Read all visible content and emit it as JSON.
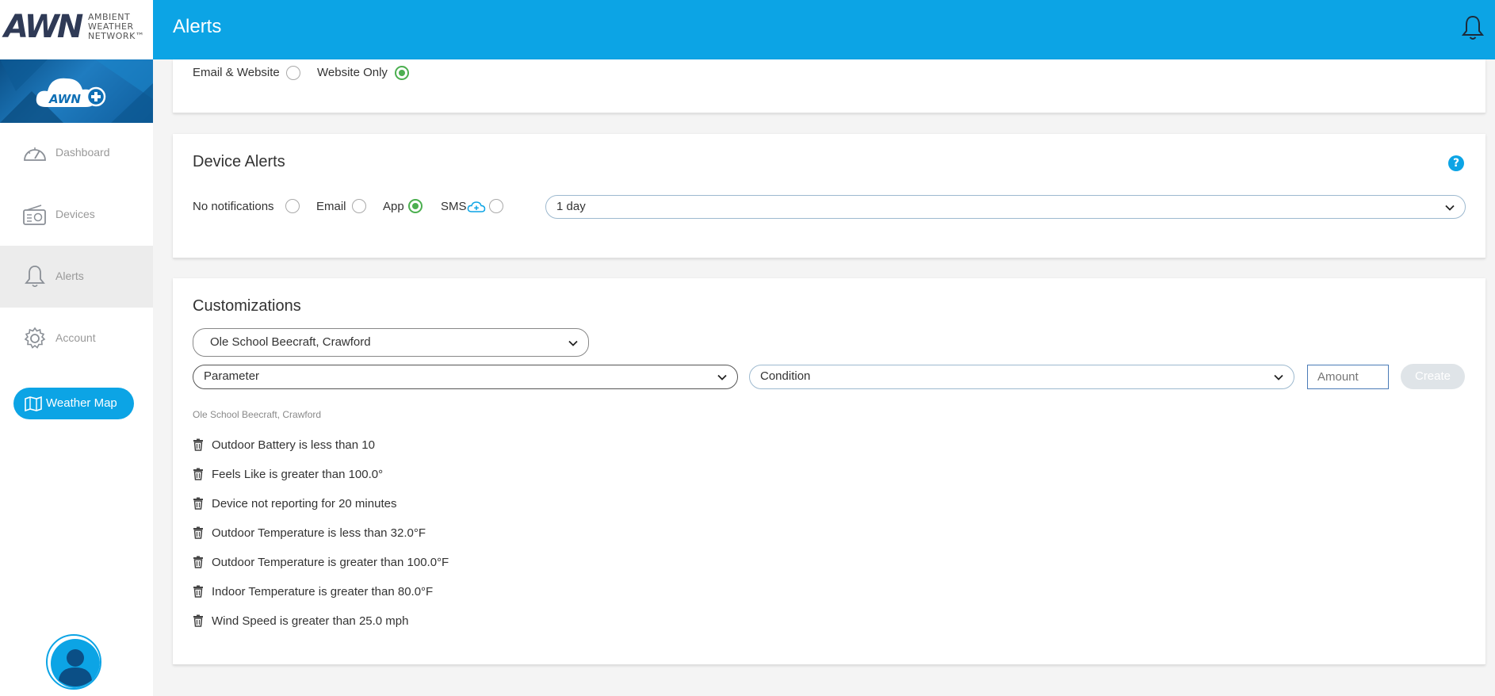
{
  "header": {
    "logo_text": "AWN",
    "logo_subtitle": [
      "AMBIENT",
      "WEATHER",
      "NETWORK™"
    ],
    "title": "Alerts",
    "bell_icon": "bell-icon"
  },
  "sidebar": {
    "banner_badge": "AWN",
    "items": [
      {
        "label": "Dashboard",
        "icon": "dashboard-gauge-icon",
        "active": false
      },
      {
        "label": "Devices",
        "icon": "radio-device-icon",
        "active": false
      },
      {
        "label": "Alerts",
        "icon": "bell-icon",
        "active": true
      },
      {
        "label": "Account",
        "icon": "gear-icon",
        "active": false
      }
    ],
    "weather_map": {
      "label": "Weather Map",
      "icon": "map-icon"
    },
    "avatar_icon": "user-avatar-icon"
  },
  "notifications_card": {
    "options": [
      {
        "label": "Email & Website",
        "checked": false
      },
      {
        "label": "Website Only",
        "checked": true
      }
    ]
  },
  "device_alerts": {
    "title": "Device Alerts",
    "help": "?",
    "options": [
      {
        "label": "No notifications",
        "checked": false
      },
      {
        "label": "Email",
        "checked": false
      },
      {
        "label": "App",
        "checked": true
      },
      {
        "label": "SMS",
        "checked": false,
        "icon": "cloud-plus-icon"
      }
    ],
    "frequency_select": "1 day"
  },
  "customizations": {
    "title": "Customizations",
    "station_select": "Ole School Beecraft, Crawford",
    "parameter_select": "Parameter",
    "condition_select": "Condition",
    "amount_placeholder": "Amount",
    "create_label": "Create",
    "station_caption": "Ole School Beecraft, Crawford",
    "alerts": [
      "Outdoor Battery is less than 10",
      "Feels Like is greater than 100.0°",
      "Device not reporting for 20 minutes",
      "Outdoor Temperature is less than 32.0°F",
      "Outdoor Temperature is greater than 100.0°F",
      "Indoor Temperature is greater than 80.0°F",
      "Wind Speed is greater than 25.0 mph"
    ]
  },
  "colors": {
    "header_blue": "#0ca4e5",
    "radio_checked": "#4caf50",
    "sidebar_active_bg": "#ececec"
  }
}
